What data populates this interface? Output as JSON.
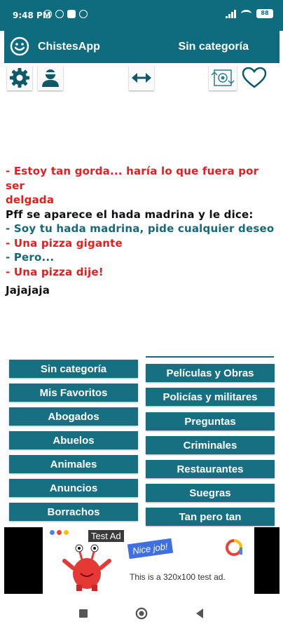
{
  "status_bar": {
    "time": "9:48 PM",
    "battery": "88",
    "icons": [
      "notification-icon",
      "whatsapp-icon",
      "youtube-icon",
      "whatsapp-icon"
    ]
  },
  "header": {
    "app_name": "ChistesApp",
    "category": "Sin categoría",
    "color": "#0f6c7f"
  },
  "toolbar": {
    "icons": [
      "gear-icon",
      "user-icon",
      "swap-arrows-icon",
      "share-image-icon",
      "heart-icon"
    ]
  },
  "joke": {
    "lines": [
      {
        "text": "- Estoy tan gorda... haría lo que fuera por ser",
        "color": "red"
      },
      {
        "text": "delgada",
        "color": "red"
      },
      {
        "text": "Pff se aparece el hada madrina y le dice:",
        "color": "black"
      },
      {
        "text": "- Soy tu hada madrina, pide cualquier deseo",
        "color": "teal"
      },
      {
        "text": "- Una pizza gigante",
        "color": "red"
      },
      {
        "text": "- Pero...",
        "color": "teal"
      },
      {
        "text": "- Una pizza dije!",
        "color": "red"
      },
      {
        "text": "Jajajaja",
        "color": "black"
      }
    ],
    "colors": {
      "red": "#e81c1c",
      "black": "#111111",
      "teal": "#15697a"
    }
  },
  "categories": {
    "left": [
      "Sin categoría",
      "Mis Favoritos",
      "Abogados",
      "Abuelos",
      "Animales",
      "Anuncios",
      "Borrachos"
    ],
    "right": [
      "Películas y Obras",
      "Policías y militares",
      "Preguntas",
      "Criminales",
      "Restaurantes",
      "Suegras",
      "Tan pero tan"
    ]
  },
  "ad": {
    "label": "Test Ad",
    "badge": "Nice job!",
    "description": "This is a 320x100 test ad."
  },
  "nav": {
    "buttons": [
      "recents-square-icon",
      "home-circle-icon",
      "back-triangle-icon"
    ]
  }
}
